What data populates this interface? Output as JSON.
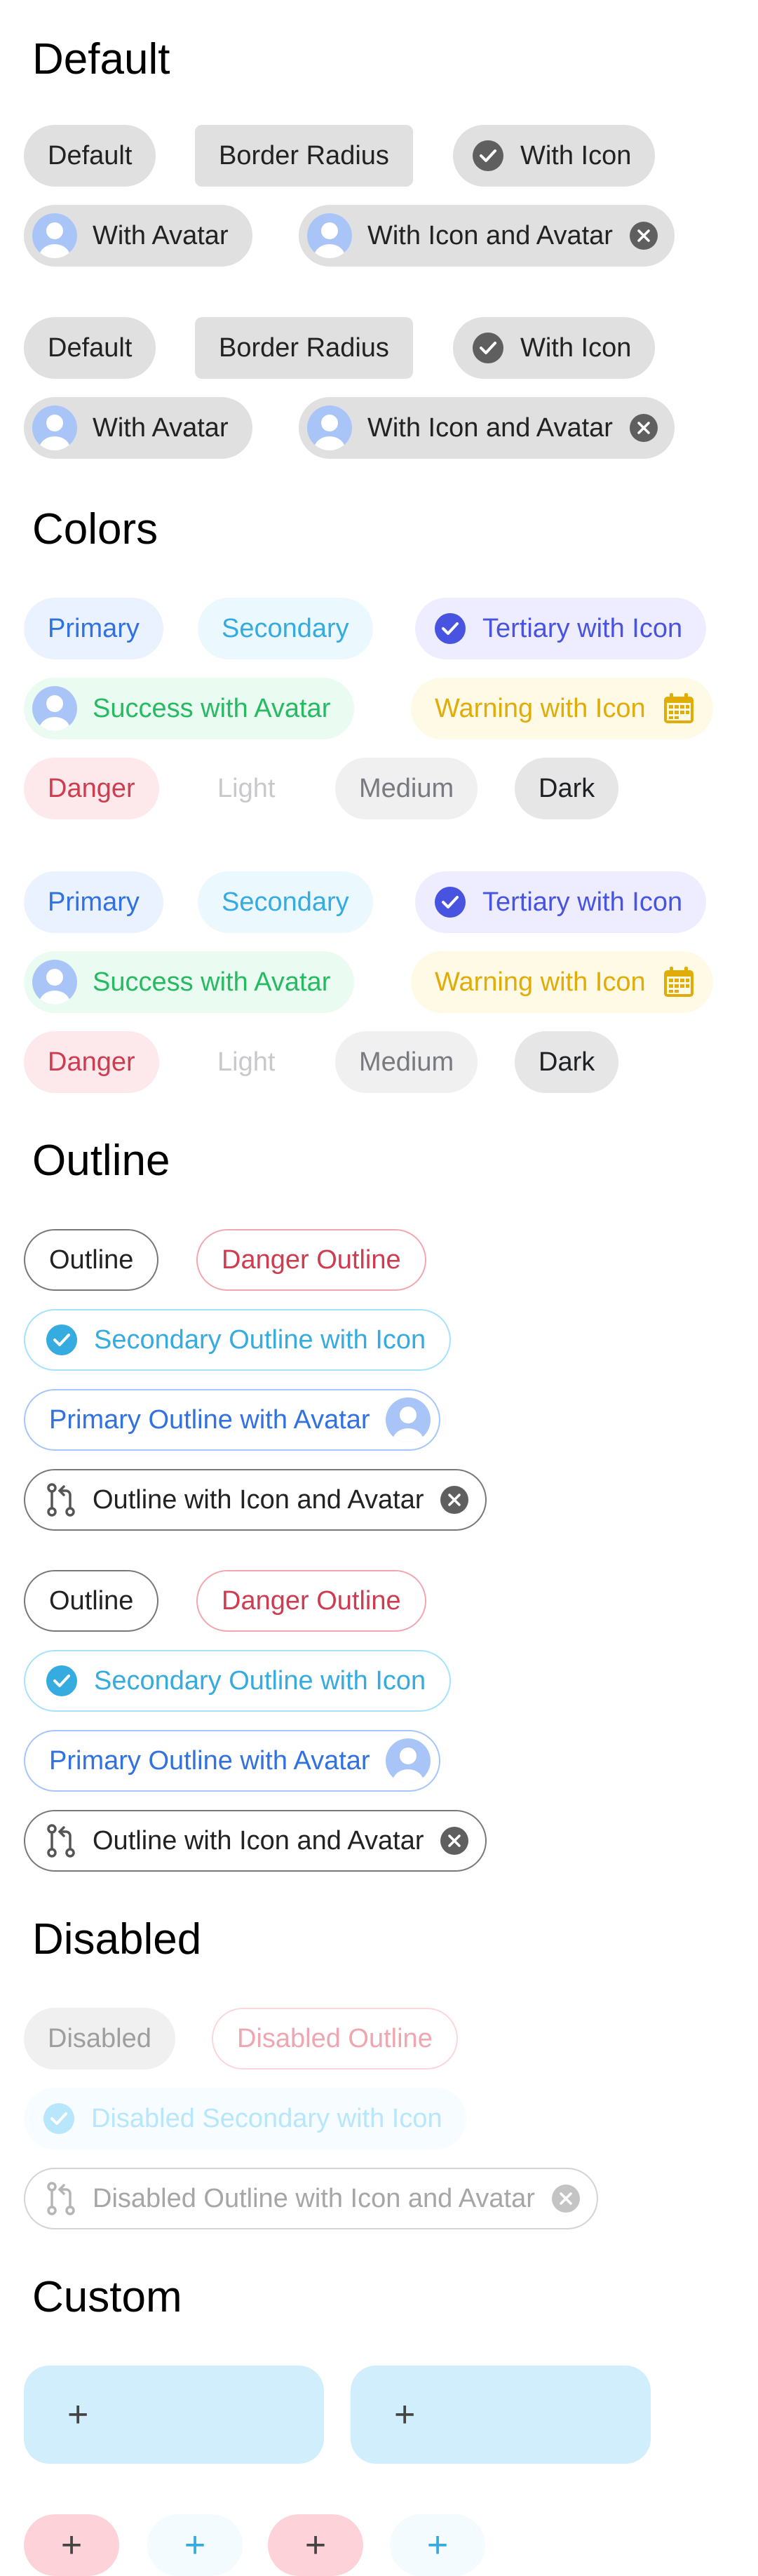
{
  "sections": {
    "default": "Default",
    "colors": "Colors",
    "outline": "Outline",
    "disabled": "Disabled",
    "custom": "Custom"
  },
  "default_chips": {
    "default": "Default",
    "border_radius": "Border Radius",
    "with_icon": "With Icon",
    "with_avatar": "With Avatar",
    "with_icon_avatar": "With Icon and Avatar"
  },
  "color_chips": {
    "primary": "Primary",
    "secondary": "Secondary",
    "tertiary": "Tertiary with Icon",
    "success": "Success with Avatar",
    "warning": "Warning with Icon",
    "danger": "Danger",
    "light": "Light",
    "medium": "Medium",
    "dark": "Dark"
  },
  "outline_chips": {
    "outline": "Outline",
    "danger": "Danger Outline",
    "secondary": "Secondary Outline with Icon",
    "primary": "Primary Outline with Avatar",
    "icon_avatar": "Outline with Icon and Avatar"
  },
  "disabled_chips": {
    "disabled": "Disabled",
    "outline": "Disabled Outline",
    "secondary": "Disabled Secondary with Icon",
    "icon_avatar": "Disabled Outline with Icon and Avatar"
  },
  "custom_chips": {
    "plus": "+"
  },
  "icons": [
    "checkmark-circle-icon",
    "close-circle-icon",
    "calendar-icon",
    "git-pull-request-icon",
    "person-avatar",
    "plus-icon"
  ],
  "colors": {
    "primary": "#3880ff",
    "secondary": "#3dc2ff",
    "tertiary": "#5260ff",
    "success": "#2dd36f",
    "warning": "#ffc409",
    "danger": "#eb445a",
    "custom_blue_bg": "#d0eefb",
    "custom_pink_bg": "#fdd3d9"
  }
}
